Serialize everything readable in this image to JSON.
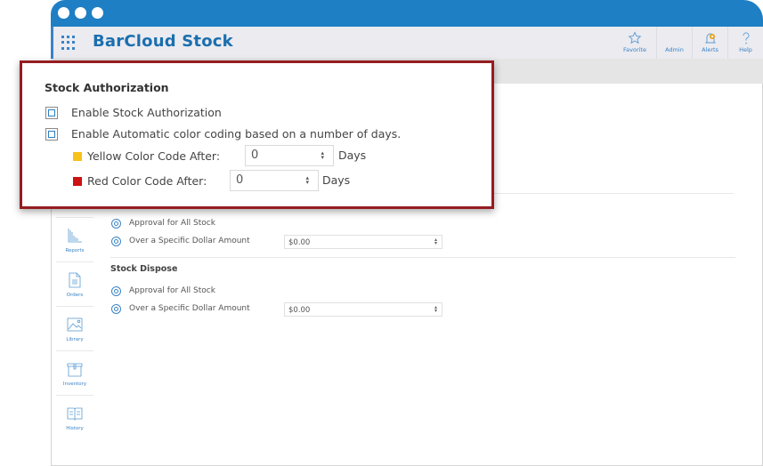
{
  "app": {
    "title": "BarCloud Stock"
  },
  "top_actions": [
    {
      "label": "Favorite",
      "icon": "star-icon"
    },
    {
      "label": "Admin",
      "icon": "admin-icon"
    },
    {
      "label": "Alerts",
      "icon": "bell-icon"
    },
    {
      "label": "Help",
      "icon": "question-icon"
    }
  ],
  "sidebar": {
    "items": [
      {
        "label": "Reports",
        "icon": "bar-chart-icon"
      },
      {
        "label": "Orders",
        "icon": "document-icon"
      },
      {
        "label": "Library",
        "icon": "image-icon"
      },
      {
        "label": "Inventory",
        "icon": "box-icon"
      },
      {
        "label": "History",
        "icon": "book-icon"
      }
    ]
  },
  "callout": {
    "title": "Stock Authorization",
    "enable_authorization": {
      "label": "Enable Stock Authorization",
      "checked": false
    },
    "enable_color_coding": {
      "label": "Enable Automatic color coding based on a number of days.",
      "checked": false
    },
    "yellow": {
      "label": "Yellow Color Code After:",
      "value": "0",
      "unit": "Days",
      "color": "#f9c21a"
    },
    "red": {
      "label": "Red Color Code After:",
      "value": "0",
      "unit": "Days",
      "color": "#cc1212"
    }
  },
  "main": {
    "stock_transfer": {
      "option_all": "Approval for All Stock",
      "option_amount": "Over a Specific Dollar Amount",
      "amount": "$0.00"
    },
    "stock_dispose": {
      "title": "Stock Dispose",
      "option_all": "Approval for All Stock",
      "option_amount": "Over a Specific Dollar Amount",
      "amount": "$0.00"
    }
  },
  "colors": {
    "brand_blue": "#1f7fc4",
    "title_blue": "#1b6fae",
    "callout_border": "#951c20"
  }
}
